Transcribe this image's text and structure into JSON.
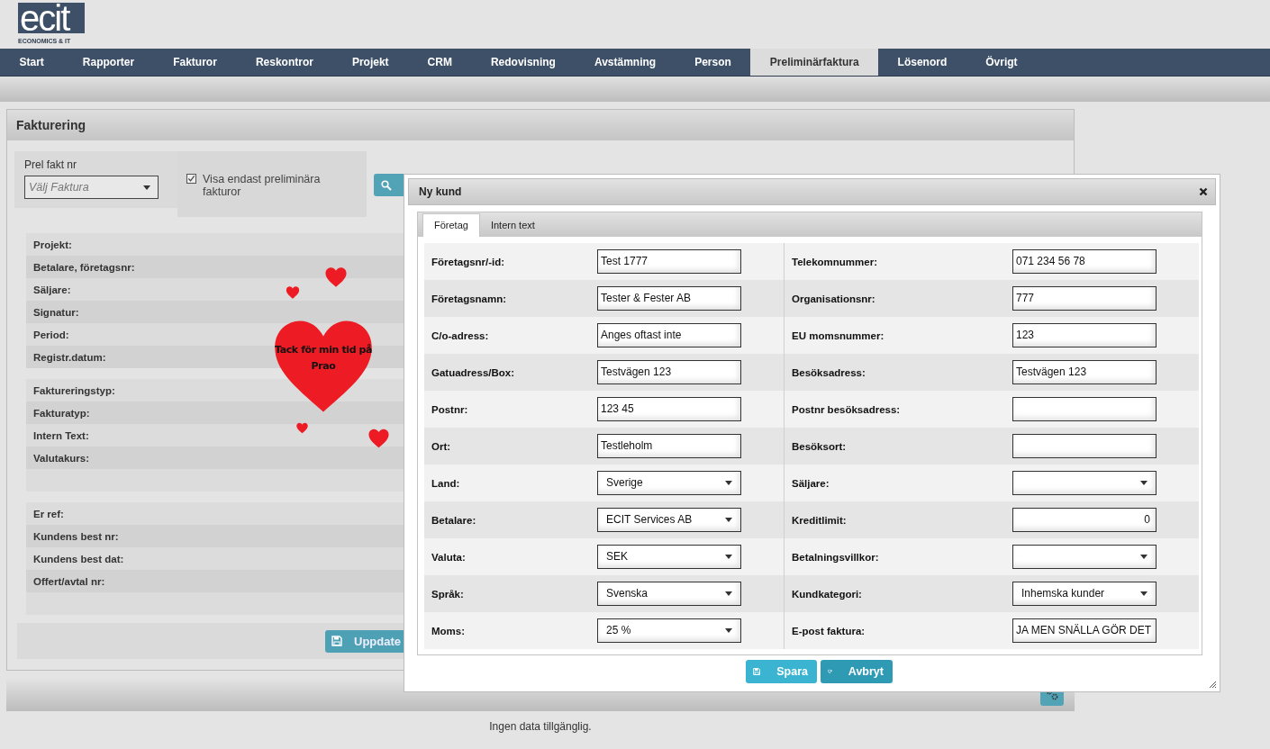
{
  "logo": {
    "wordmark": "ecit",
    "tagline": "ECONOMICS & IT"
  },
  "nav": [
    {
      "label": "Start",
      "selected": false
    },
    {
      "label": "Rapporter",
      "selected": false
    },
    {
      "label": "Fakturor",
      "selected": false
    },
    {
      "label": "Reskontror",
      "selected": false
    },
    {
      "label": "Projekt",
      "selected": false
    },
    {
      "label": "CRM",
      "selected": false
    },
    {
      "label": "Redovisning",
      "selected": false
    },
    {
      "label": "Avstämning",
      "selected": false
    },
    {
      "label": "Person",
      "selected": false
    },
    {
      "label": "Preliminärfaktura",
      "selected": true
    },
    {
      "label": "Lösenord",
      "selected": false
    },
    {
      "label": "Övrigt",
      "selected": false
    }
  ],
  "panel": {
    "title": "Fakturering",
    "invoice_select": {
      "label": "Prel fakt nr",
      "placeholder": "Välj Faktura"
    },
    "checkbox": {
      "label": "Visa endast preliminära fakturor",
      "checked": true
    },
    "groups": [
      {
        "labels": [
          "Projekt:",
          "Betalare, företagsnr:",
          "Säljare:",
          "Signatur:",
          "Period:",
          "Registr.datum:"
        ],
        "trailing_blank": false
      },
      {
        "labels": [
          "Faktureringstyp:",
          "Fakturatyp:",
          "Intern Text:",
          "Valutakurs:"
        ],
        "trailing_blank": true
      },
      {
        "labels": [
          "Er ref:",
          "Kundens best nr:",
          "Kundens best dat:",
          "Offert/avtal nr:"
        ],
        "trailing_blank": true
      }
    ],
    "update_button": "Uppdate"
  },
  "footer_message": "Ingen data tillgänglig.",
  "note": {
    "text": "Tack för min tid på Prao"
  },
  "dialog": {
    "title": "Ny kund",
    "tabs": [
      {
        "label": "Företag",
        "selected": true
      },
      {
        "label": "Intern text",
        "selected": false
      }
    ],
    "rows": [
      {
        "left": {
          "label": "Företagsnr/-id:",
          "kind": "input",
          "value": "Test 1777"
        },
        "right": {
          "label": "Telekomnummer:",
          "kind": "input",
          "value": "071 234 56 78"
        }
      },
      {
        "left": {
          "label": "Företagsnamn:",
          "kind": "input",
          "value": "Tester & Fester AB"
        },
        "right": {
          "label": "Organisationsnr:",
          "kind": "input",
          "value": "777"
        }
      },
      {
        "left": {
          "label": "C/o-adress:",
          "kind": "input",
          "value": "Anges oftast inte"
        },
        "right": {
          "label": "EU momsnummer:",
          "kind": "input",
          "value": "123"
        }
      },
      {
        "left": {
          "label": "Gatuadress/Box:",
          "kind": "input",
          "value": "Testvägen 123"
        },
        "right": {
          "label": "Besöksadress:",
          "kind": "input",
          "value": "Testvägen 123"
        }
      },
      {
        "left": {
          "label": "Postnr:",
          "kind": "input",
          "value": "123 45"
        },
        "right": {
          "label": "Postnr besöksadress:",
          "kind": "input"
        }
      },
      {
        "left": {
          "label": "Ort:",
          "kind": "input",
          "value": "Testleholm"
        },
        "right": {
          "label": "Besöksort:",
          "kind": "input"
        }
      },
      {
        "left": {
          "label": "Land:",
          "kind": "select",
          "value": "Sverige"
        },
        "right": {
          "label": "Säljare:",
          "kind": "select"
        }
      },
      {
        "left": {
          "label": "Betalare:",
          "kind": "select",
          "value": "ECIT Services AB"
        },
        "right": {
          "label": "Kreditlimit:",
          "kind": "number",
          "value": "0"
        }
      },
      {
        "left": {
          "label": "Valuta:",
          "kind": "select",
          "value": "SEK"
        },
        "right": {
          "label": "Betalningsvillkor:",
          "kind": "select"
        }
      },
      {
        "left": {
          "label": "Språk:",
          "kind": "select",
          "value": "Svenska"
        },
        "right": {
          "label": "Kundkategori:",
          "kind": "select",
          "value": "Inhemska kunder"
        }
      },
      {
        "left": {
          "label": "Moms:",
          "kind": "select",
          "value": "25 %"
        },
        "right": {
          "label": "E-post faktura:",
          "kind": "input",
          "value": "JA MEN SNÄLLA GÖR DET"
        }
      }
    ],
    "buttons": [
      {
        "label": "Spara",
        "kind": "save"
      },
      {
        "label": "Avbryt",
        "kind": "cancel"
      }
    ]
  }
}
